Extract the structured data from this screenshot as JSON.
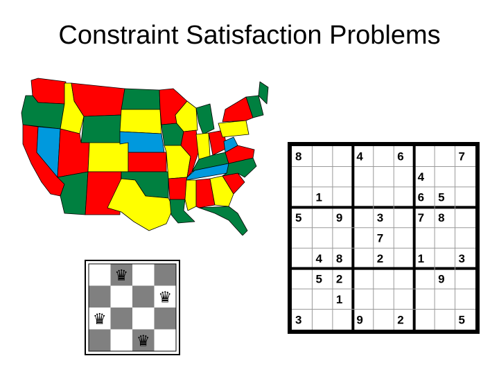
{
  "slide": {
    "title": "Constraint Satisfaction Problems"
  },
  "colors": {
    "red": "#ff0000",
    "green": "#008040",
    "yellow": "#ffff00",
    "blue": "#0099dd",
    "board_dark": "#808080",
    "board_light": "#ffffff"
  },
  "map": {
    "icon": "us-states-map-colored",
    "regions": [
      {
        "name": "washington",
        "color": "red"
      },
      {
        "name": "oregon",
        "color": "green"
      },
      {
        "name": "california",
        "color": "red"
      },
      {
        "name": "nevada",
        "color": "blue"
      },
      {
        "name": "idaho",
        "color": "yellow"
      },
      {
        "name": "montana",
        "color": "red"
      },
      {
        "name": "wyoming",
        "color": "green"
      },
      {
        "name": "utah",
        "color": "red"
      },
      {
        "name": "arizona",
        "color": "green"
      },
      {
        "name": "colorado",
        "color": "yellow"
      },
      {
        "name": "new-mexico",
        "color": "red"
      },
      {
        "name": "north-dakota",
        "color": "green"
      },
      {
        "name": "south-dakota",
        "color": "yellow"
      },
      {
        "name": "nebraska",
        "color": "blue"
      },
      {
        "name": "kansas",
        "color": "red"
      },
      {
        "name": "oklahoma",
        "color": "green"
      },
      {
        "name": "texas",
        "color": "yellow"
      },
      {
        "name": "minnesota",
        "color": "red"
      },
      {
        "name": "iowa",
        "color": "green"
      },
      {
        "name": "missouri",
        "color": "yellow"
      },
      {
        "name": "arkansas",
        "color": "red"
      },
      {
        "name": "louisiana",
        "color": "green"
      },
      {
        "name": "wisconsin",
        "color": "yellow"
      },
      {
        "name": "illinois",
        "color": "red"
      },
      {
        "name": "michigan",
        "color": "green"
      },
      {
        "name": "indiana",
        "color": "yellow"
      },
      {
        "name": "ohio",
        "color": "red"
      },
      {
        "name": "kentucky",
        "color": "green"
      },
      {
        "name": "tennessee",
        "color": "blue"
      },
      {
        "name": "mississippi",
        "color": "yellow"
      },
      {
        "name": "alabama",
        "color": "red"
      },
      {
        "name": "georgia",
        "color": "yellow"
      },
      {
        "name": "florida",
        "color": "green"
      },
      {
        "name": "south-carolina",
        "color": "red"
      },
      {
        "name": "north-carolina",
        "color": "green"
      },
      {
        "name": "virginia",
        "color": "red"
      },
      {
        "name": "west-virginia",
        "color": "blue"
      },
      {
        "name": "pennsylvania",
        "color": "yellow"
      },
      {
        "name": "new-york",
        "color": "red"
      },
      {
        "name": "new-england",
        "color": "green"
      },
      {
        "name": "maine",
        "color": "green"
      }
    ]
  },
  "sudoku": {
    "rows": [
      [
        "8",
        "",
        "",
        "4",
        "",
        "6",
        "",
        "",
        "7"
      ],
      [
        "",
        "",
        "",
        "",
        "",
        "",
        "4",
        "",
        ""
      ],
      [
        "",
        "1",
        "",
        "",
        "",
        "",
        "6",
        "5",
        ""
      ],
      [
        "5",
        "",
        "9",
        "",
        "3",
        "",
        "7",
        "8",
        ""
      ],
      [
        "",
        "",
        "",
        "",
        "7",
        "",
        "",
        "",
        ""
      ],
      [
        "",
        "4",
        "8",
        "",
        "2",
        "",
        "1",
        "",
        "3"
      ],
      [
        "",
        "5",
        "2",
        "",
        "",
        "",
        "",
        "9",
        ""
      ],
      [
        "",
        "",
        "1",
        "",
        "",
        "",
        "",
        "",
        ""
      ],
      [
        "3",
        "",
        "",
        "9",
        "",
        "2",
        "",
        "",
        "5"
      ]
    ]
  },
  "queens": {
    "size": 4,
    "icon": "chess-queen-icon",
    "glyph": "♛",
    "positions": [
      [
        0,
        1
      ],
      [
        1,
        3
      ],
      [
        2,
        0
      ],
      [
        3,
        2
      ]
    ]
  }
}
